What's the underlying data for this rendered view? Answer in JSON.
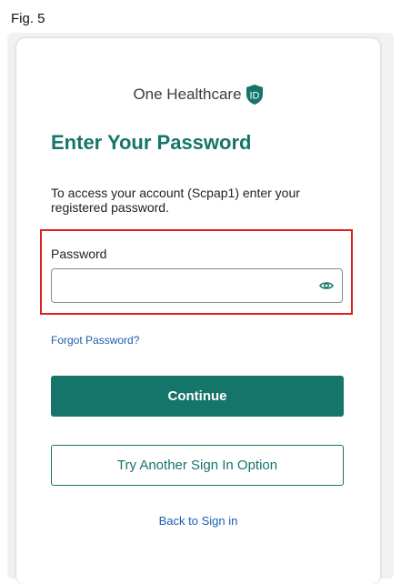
{
  "figure": {
    "label": "Fig. 5"
  },
  "brand": {
    "name": "One Healthcare",
    "badge_text": "ID",
    "color": "#15756b"
  },
  "form": {
    "title": "Enter Your Password",
    "description": "To access your account (Scpap1) enter your registered password.",
    "password_label": "Password",
    "password_value": "",
    "show_password_icon": "eye-icon"
  },
  "links": {
    "forgot_password": "Forgot Password?",
    "back_to_sign_in": "Back to Sign in"
  },
  "buttons": {
    "continue": "Continue",
    "try_another": "Try Another Sign In Option"
  },
  "colors": {
    "accent": "#15756b",
    "link": "#1a5fae",
    "highlight": "#e0201f"
  }
}
